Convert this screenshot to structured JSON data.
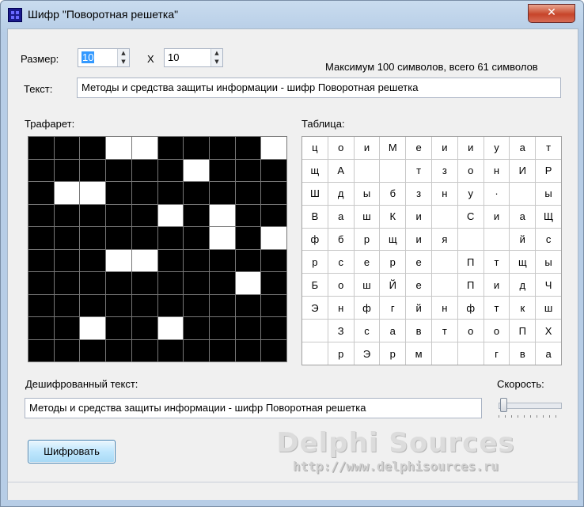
{
  "window": {
    "title": "Шифр \"Поворотная решетка\"",
    "close_label": "✕"
  },
  "size": {
    "label": "Размер:",
    "rows": "10",
    "separator": "X",
    "cols": "10"
  },
  "info": "Максимум 100 символов, всего 61 символов",
  "text": {
    "label": "Текст:",
    "value": "Методы и средства защиты информации - шифр Поворотная решетка"
  },
  "stencil": {
    "label": "Трафарет:",
    "rows": [
      [
        0,
        0,
        0,
        1,
        1,
        0,
        0,
        0,
        0,
        1
      ],
      [
        0,
        0,
        0,
        0,
        0,
        0,
        1,
        0,
        0,
        0
      ],
      [
        0,
        1,
        1,
        0,
        0,
        0,
        0,
        0,
        0,
        0
      ],
      [
        0,
        0,
        0,
        0,
        0,
        1,
        0,
        1,
        0,
        0
      ],
      [
        0,
        0,
        0,
        0,
        0,
        0,
        0,
        1,
        0,
        1
      ],
      [
        0,
        0,
        0,
        1,
        1,
        0,
        0,
        0,
        0,
        0
      ],
      [
        0,
        0,
        0,
        0,
        0,
        0,
        0,
        0,
        1,
        0
      ],
      [
        0,
        0,
        0,
        0,
        0,
        0,
        0,
        0,
        0,
        0
      ],
      [
        0,
        0,
        1,
        0,
        0,
        1,
        0,
        0,
        0,
        0
      ],
      [
        0,
        0,
        0,
        0,
        0,
        0,
        0,
        0,
        0,
        0
      ]
    ]
  },
  "table": {
    "label": "Таблица:",
    "rows": [
      [
        "ц",
        "о",
        "и",
        "М",
        "е",
        "и",
        "и",
        "у",
        "а",
        "т"
      ],
      [
        "щ",
        "А",
        "",
        "",
        "т",
        "з",
        "о",
        "н",
        "И",
        "Р"
      ],
      [
        "Ш",
        "д",
        "ы",
        "б",
        "з",
        "н",
        "у",
        "·",
        "",
        "ы"
      ],
      [
        "В",
        "а",
        "ш",
        "К",
        "и",
        "",
        "С",
        "и",
        "а",
        "Щ"
      ],
      [
        "ф",
        "б",
        "р",
        "щ",
        "и",
        "я",
        "",
        "",
        "й",
        "с"
      ],
      [
        "р",
        "с",
        "е",
        "р",
        "е",
        "",
        "П",
        "т",
        "щ",
        "ы"
      ],
      [
        "Б",
        "о",
        "ш",
        "Й",
        "е",
        "",
        "П",
        "и",
        "д",
        "Ч"
      ],
      [
        "Э",
        "н",
        "ф",
        "г",
        "й",
        "н",
        "ф",
        "т",
        "к",
        "ш"
      ],
      [
        "",
        "З",
        "с",
        "а",
        "в",
        "т",
        "о",
        "о",
        "П",
        "Х"
      ],
      [
        "",
        "р",
        "Э",
        "р",
        "м",
        "",
        "",
        "г",
        "в",
        "а"
      ]
    ]
  },
  "decrypted": {
    "label": "Дешифрованный текст:",
    "value": "Методы и средства защиты информации - шифр Поворотная решетка"
  },
  "speed": {
    "label": "Скорость:",
    "level": 0
  },
  "encrypt_button": "Шифровать",
  "watermark": {
    "line1": "Delphi Sources",
    "line2": "http://www.delphisources.ru"
  },
  "colors": {
    "title_bg": "#c9dcef",
    "close_red": "#c7452a",
    "button_blue": "#bee6fd",
    "selection": "#3399ff"
  }
}
